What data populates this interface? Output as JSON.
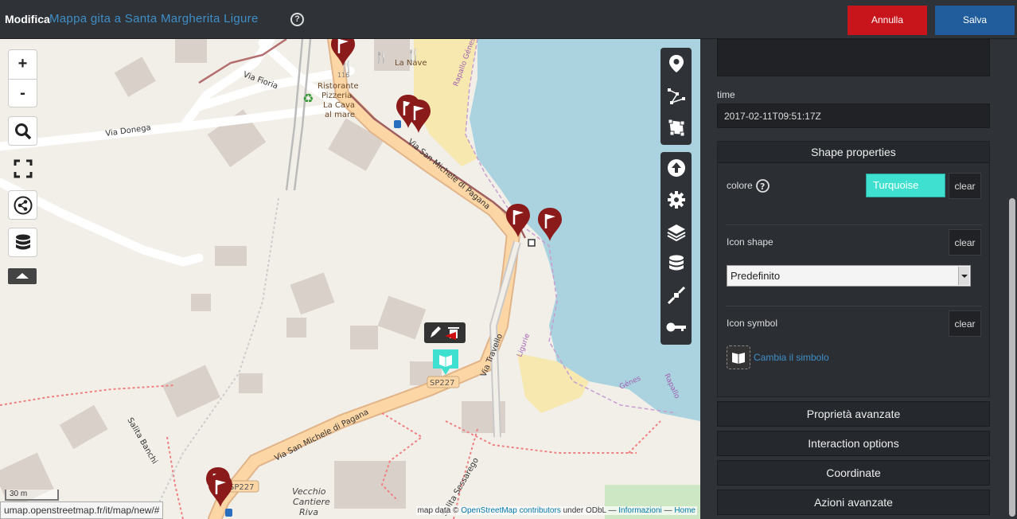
{
  "header": {
    "mode_label": "Modifica",
    "map_title": "Mappa gita a Santa Margherita Ligure",
    "help_label": "?",
    "cancel_label": "Annulla",
    "save_label": "Salva"
  },
  "map": {
    "zoom_in": "+",
    "zoom_out": "-",
    "scale_label": "30 m",
    "url": "umap.openstreetmap.fr/it/map/new/#",
    "attribution": {
      "prefix": "map data ©",
      "osm_link": "OpenStreetMap contributors",
      "under": "under ODbL —",
      "info_link": "Informazioni",
      "dash": "—",
      "home_link": "Home"
    },
    "labels": {
      "via_fioria": "Via Fioria",
      "via_donega": "Via Donega",
      "via_san_michele_1": "Via San Michele di Pagana",
      "via_san_michele_2": "Via San Michele di Pagana",
      "via_travello": "Via Travello",
      "salita_banchi": "Salita Banchi",
      "salita_sessarego": "Salita Sessarego",
      "la_nave": "La Nave",
      "ristorante_1": "Ristorante",
      "ristorante_2": "Pizzeria",
      "ristorante_3": "La Cava",
      "ristorante_4": "al mare",
      "vecchio_1": "Vecchio",
      "vecchio_2": "Cantiere",
      "vecchio_3": "Riva",
      "sp227": "SP227",
      "sp227b": "SP227",
      "num_116": "116",
      "rapallo_genes_1": "Rapallo Génes",
      "liguria": "Ligurie",
      "genes": "Génes",
      "rapallo_2": "Rapallo"
    },
    "icons": [
      "map-marker-icon",
      "polyline-icon",
      "polygon-icon",
      "upload-icon",
      "gear-icon",
      "layers-icon",
      "database-icon",
      "center-icon",
      "key-icon",
      "search-icon",
      "fullscreen-icon",
      "share-icon"
    ]
  },
  "panel": {
    "time_label": "time",
    "time_value": "2017-02-11T09:51:17Z",
    "shape_properties": "Shape properties",
    "colore_label": "colore",
    "colore_value": "Turquoise",
    "colore_hex": "#40e0d0",
    "clear_label": "clear",
    "icon_shape_label": "Icon shape",
    "icon_shape_value": "Predefinito",
    "icon_symbol_label": "Icon symbol",
    "change_symbol": "Cambia il simbolo",
    "sections": [
      "Proprietà avanzate",
      "Interaction options",
      "Coordinate",
      "Azioni avanzate"
    ]
  }
}
